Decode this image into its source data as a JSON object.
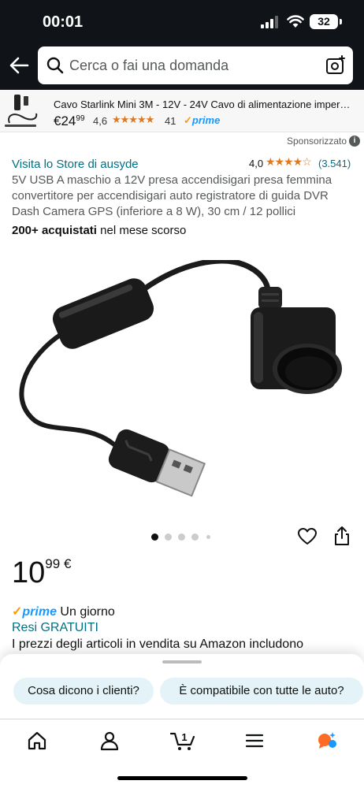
{
  "status_bar": {
    "time": "00:01",
    "battery": "32"
  },
  "search": {
    "placeholder": "Cerca o fai una domanda"
  },
  "sponsored_product": {
    "title": "Cavo Starlink Mini 3M - 12V - 24V Cavo di alimentazione imper…",
    "price_currency": "€",
    "price_whole": "24",
    "price_fraction": "99",
    "rating": "4,6",
    "stars": "★★★★★",
    "review_count": "41",
    "prime_label": "prime",
    "prime_check": "✓"
  },
  "sponsored_label": "Sponsorizzato",
  "info_glyph": "i",
  "product": {
    "store_link": "Visita lo Store di ausyde",
    "rating": "4,0",
    "stars": "★★★★☆",
    "review_count": "(3.541)",
    "title": "5V USB A maschio a 12V presa accendisigari presa femmina convertitore per accendisigari auto registratore di guida DVR Dash Camera GPS (inferiore a 8 W), 30 cm / 12 pollici",
    "bought_strong": "200+ acquistati",
    "bought_rest": " nel mese scorso",
    "price_whole": "10",
    "price_fraction": "99",
    "price_currency": "€",
    "prime_check": "✓",
    "prime_label": "prime",
    "delivery": " Un giorno",
    "returns": "Resi GRATUITI",
    "disclaimer": "I prezzi degli articoli in vendita su Amazon includono",
    "image_count": 5,
    "active_image": 1
  },
  "quick_questions": [
    {
      "label": "Cosa dicono i clienti?"
    },
    {
      "label": "È compatibile con tutte le auto?"
    }
  ],
  "bottom_nav": {
    "cart_count": "1"
  },
  "colors": {
    "top_bar": "#101318",
    "link": "#007185",
    "star": "#de7921",
    "prime_blue": "#1a98ff",
    "prime_check": "#ff9900",
    "chip_bg": "#e3f3f8"
  },
  "icons": [
    "back-arrow-icon",
    "search-icon",
    "camera-search-icon",
    "info-icon",
    "heart-icon",
    "share-icon",
    "home-icon",
    "account-icon",
    "cart-icon",
    "menu-icon",
    "rufus-assistant-icon"
  ]
}
